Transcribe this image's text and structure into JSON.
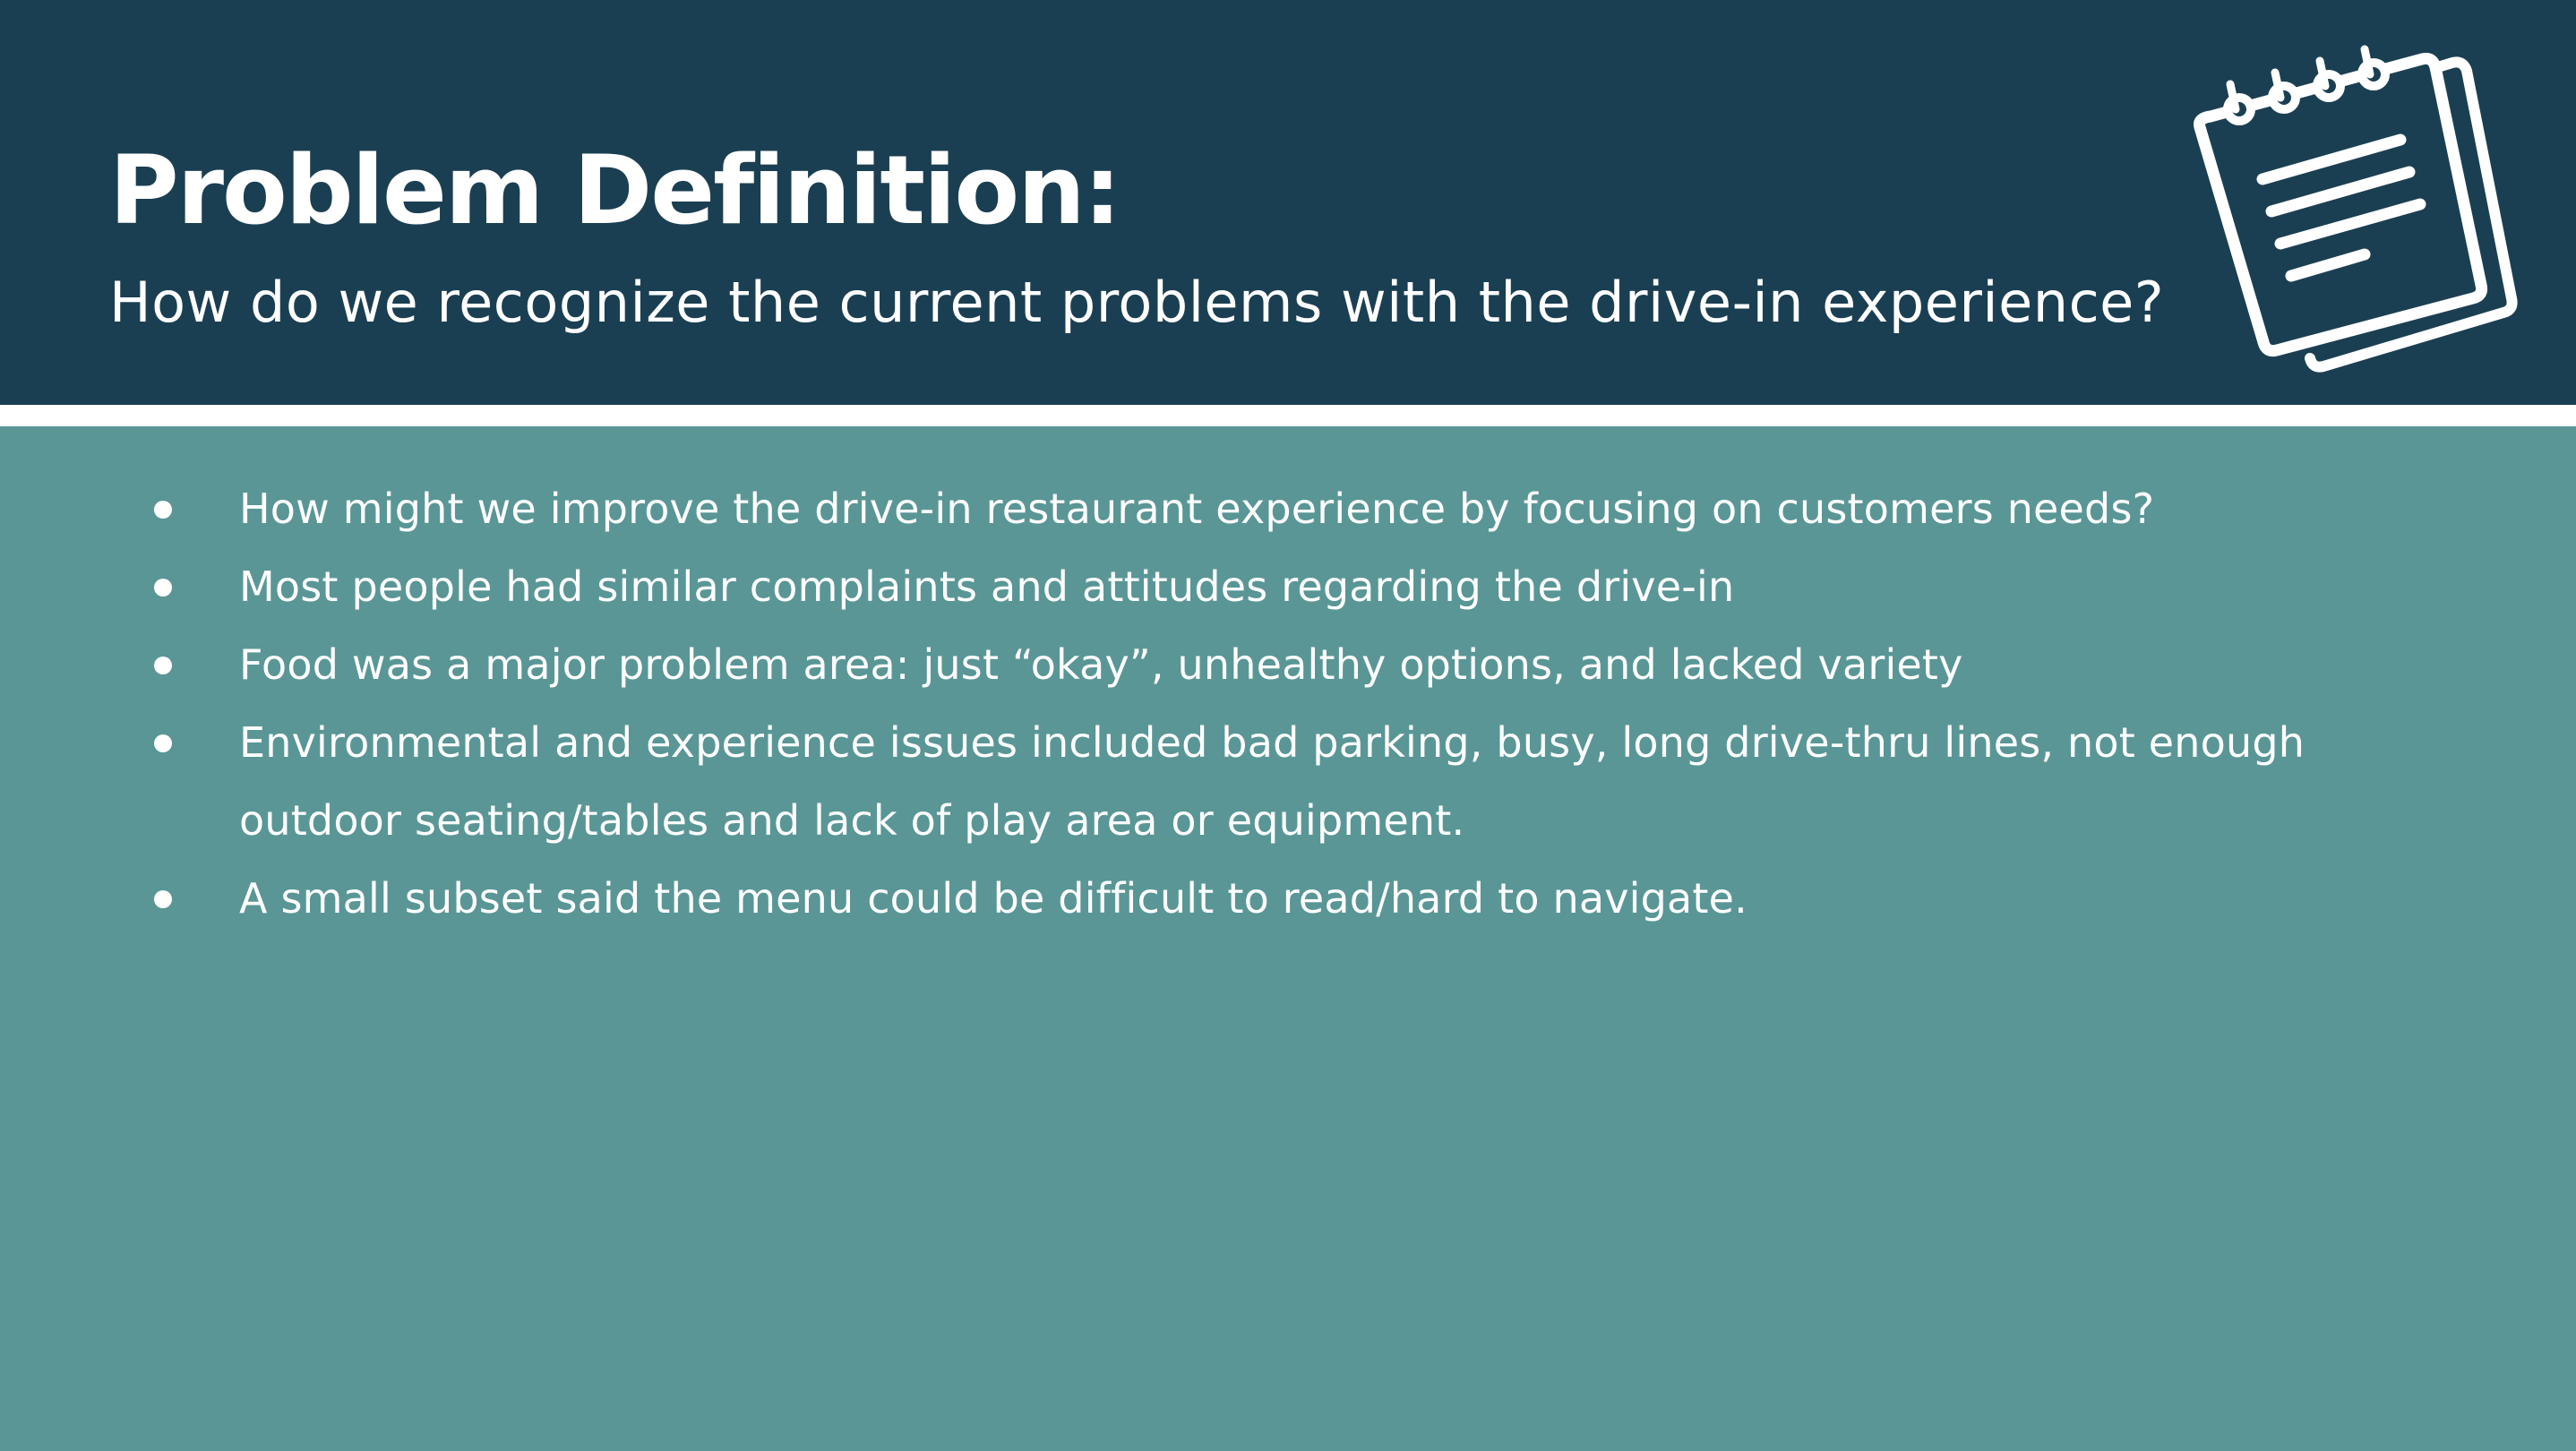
{
  "slide": {
    "title": "Problem Definition:",
    "subtitle": "How do we recognize the current problems with the drive-in experience?",
    "icon": "notepad-icon",
    "colors": {
      "header_background": "#1b3f52",
      "body_background": "#5a9696",
      "text": "#ffffff"
    }
  },
  "bullets": [
    "How might we improve the drive-in restaurant experience by focusing on customers needs?",
    "Most people had similar complaints and attitudes regarding the drive-in",
    "Food was a major problem area: just “okay”, unhealthy options, and lacked variety",
    "Environmental and experience issues included bad parking, busy, long drive-thru lines, not enough outdoor seating/tables and lack of play area or equipment.",
    "A small subset said the menu could be difficult to read/hard to navigate."
  ]
}
